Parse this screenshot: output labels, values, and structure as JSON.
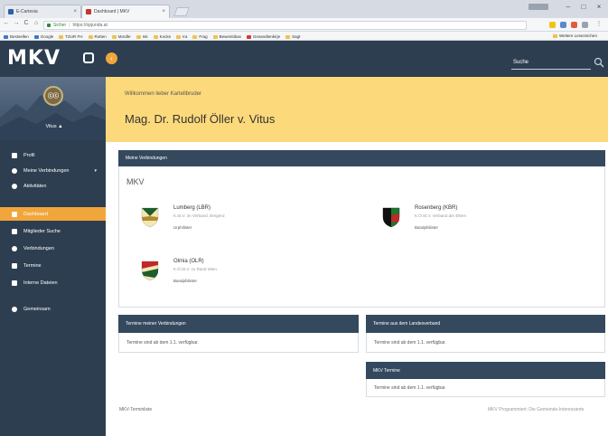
{
  "browser": {
    "tabs": [
      {
        "label": "E-Cartesia",
        "active": false
      },
      {
        "label": "Dashboard | MKV",
        "active": true
      }
    ],
    "window_controls": [
      "–",
      "□",
      "×"
    ],
    "nav": {
      "back": "←",
      "forward": "→",
      "reload": "C",
      "home": "⌂"
    },
    "url": {
      "secure_label": "Sicher",
      "address": "https://opjunda.at"
    },
    "bookmarks": [
      {
        "label": "Bestsellen",
        "color": "blue"
      },
      {
        "label": "Google",
        "color": "blue"
      },
      {
        "label": "TZUR FH",
        "color": "yellow"
      },
      {
        "label": "Rotten",
        "color": "yellow"
      },
      {
        "label": "Mordle",
        "color": "yellow"
      },
      {
        "label": "Ink",
        "color": "yellow"
      },
      {
        "label": "Kocke",
        "color": "yellow"
      },
      {
        "label": "Ira",
        "color": "yellow"
      },
      {
        "label": "Frag",
        "color": "yellow"
      },
      {
        "label": "Beweintibas",
        "color": "yellow"
      },
      {
        "label": "Gesandtenkirje",
        "color": "red"
      },
      {
        "label": "Sagt",
        "color": "yellow"
      }
    ],
    "other_bookmarks": "Weitere Lesezeichen"
  },
  "header": {
    "logo": "MKV",
    "collapse_icon": "‹",
    "search_label": "Suche"
  },
  "sidebar": {
    "emblem_text": "ⓒⓒ",
    "user_name": "Vitus ▲",
    "items": [
      {
        "label": "Profil",
        "icon": "user-icon",
        "active": false,
        "caret": ""
      },
      {
        "label": "Meine Verbindungen",
        "icon": "shield-icon",
        "active": false,
        "caret": "▾"
      },
      {
        "label": "Aktivitäten",
        "icon": "cog-icon",
        "active": false,
        "caret": ""
      },
      {
        "label": "Dashboard",
        "icon": "dashboard-icon",
        "active": true,
        "caret": ""
      },
      {
        "label": "Mitglieder Suche",
        "icon": "users-icon",
        "active": false,
        "caret": ""
      },
      {
        "label": "Verbindungen",
        "icon": "globe-icon",
        "active": false,
        "caret": ""
      },
      {
        "label": "Termine",
        "icon": "calendar-icon",
        "active": false,
        "caret": ""
      },
      {
        "label": "Interne Dateien",
        "icon": "file-icon",
        "active": false,
        "caret": ""
      },
      {
        "label": "Gemeinsam",
        "icon": "music-icon",
        "active": false,
        "caret": ""
      }
    ]
  },
  "welcome": {
    "greeting": "Willkommen lieber Kartellbruder",
    "name": "Mag. Dr. Rudolf Öller v. Vitus"
  },
  "verbindungen_panel": {
    "title": "Meine Verbindungen",
    "group": "MKV",
    "items": [
      {
        "name": "Lumberg (LBR)",
        "sub": "K.St.V. im Verband, Bregenz",
        "role": "Urphilister",
        "colors": [
          "#1e5e2b",
          "#f2e7b5",
          "#b48a2a"
        ]
      },
      {
        "name": "Rosenberg (KBR)",
        "sub": "K.Ö.St.V. Verband der Eltern",
        "role": "Bandphilister",
        "colors": [
          "#101010",
          "#1a7a2c",
          "#c0282a"
        ]
      },
      {
        "name": "Olmia (OLR)",
        "sub": "K.Ö.St.V. zu Rand Wien",
        "role": "Bandphilister",
        "colors": [
          "#c0282a",
          "#f2e7b5",
          "#1e5e2b"
        ]
      }
    ]
  },
  "termine_panel": {
    "title": "Termine meiner Verbindungen",
    "text": "Termine sind ab dem 1.1. verfügbar."
  },
  "landesverband_panel": {
    "title": "Termine aus dem Landesverband",
    "text": "Termine sind ab dem 1.1. verfügbar."
  },
  "mkv_panel": {
    "title": "MKV Termine",
    "text": "Termine sind ab dem 1.1. verfügbar."
  },
  "footer": {
    "left": "MKV-Terminliste",
    "right": "MKV Programmiert: Die Gemeinde-Interessierte"
  },
  "colors": {
    "sidebar": "#2d3e50",
    "accent": "#f1a63c",
    "banner": "#fcd97b",
    "panel_header": "#34495e"
  }
}
